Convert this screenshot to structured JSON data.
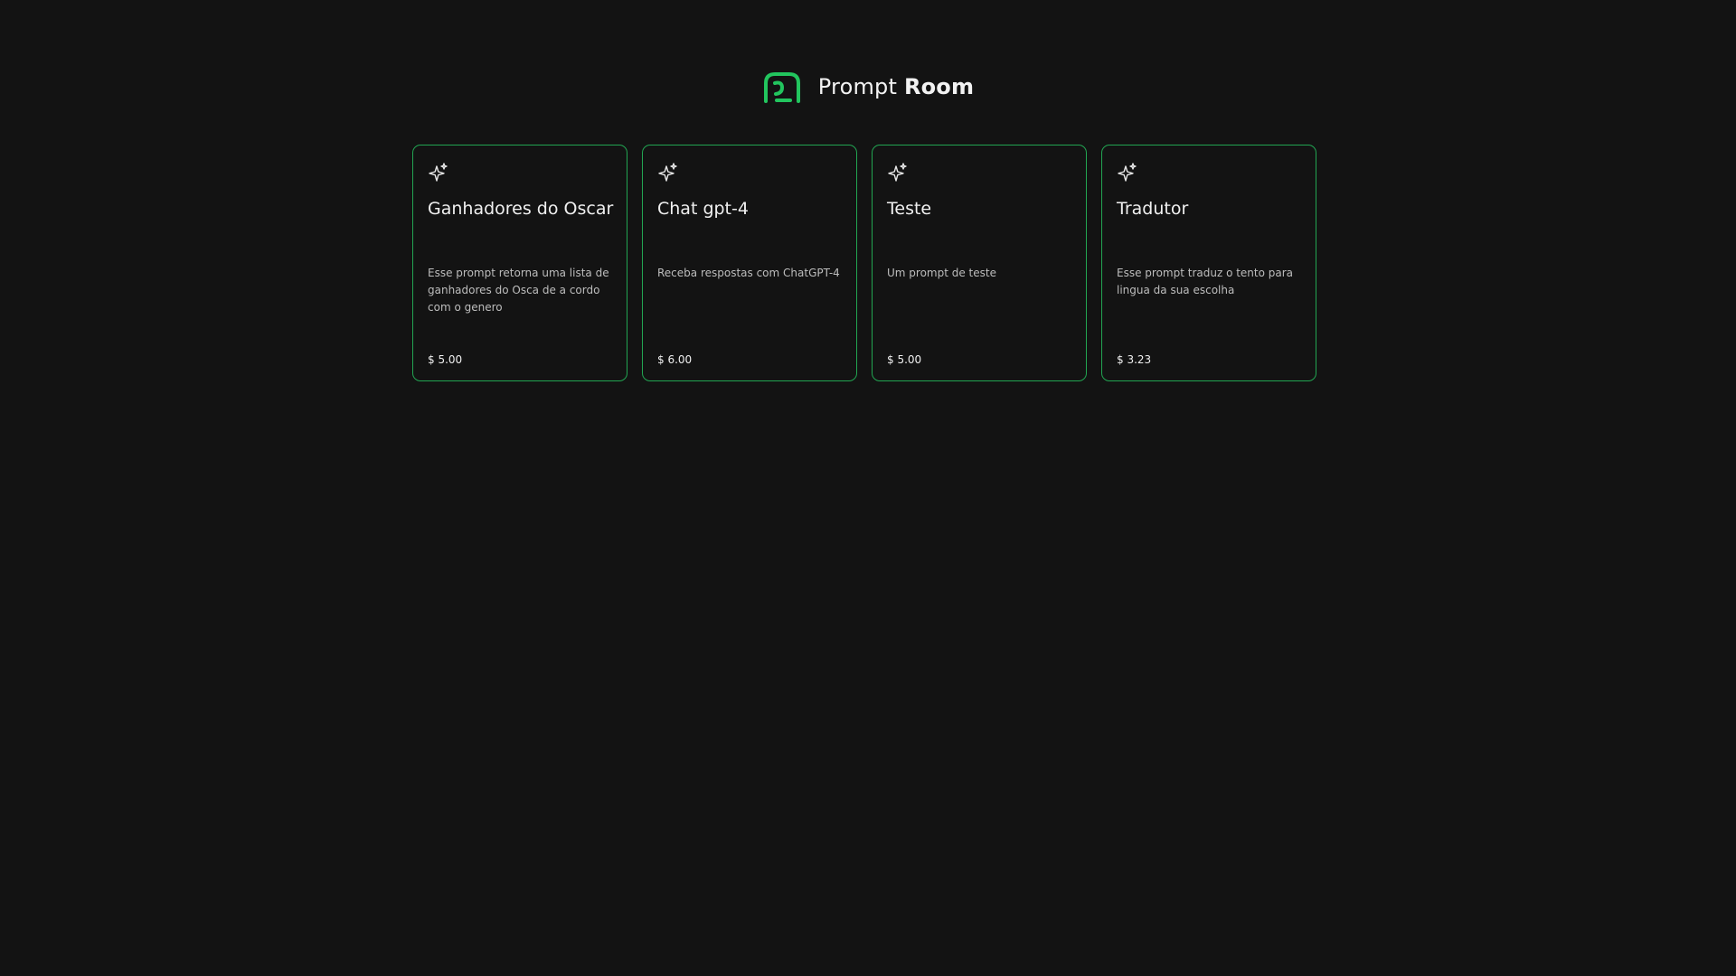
{
  "header": {
    "brand_light": "Prompt",
    "brand_bold": "Room",
    "logo_icon": "prompt-room-logo-icon",
    "accent_color": "#22c55e"
  },
  "cards": [
    {
      "icon": "sparkles-icon",
      "title": "Ganhadores do Oscar",
      "description": "Esse prompt retorna uma lista de ganhadores do Osca de a cordo com o genero",
      "price": "$ 5.00"
    },
    {
      "icon": "sparkles-icon",
      "title": "Chat gpt-4",
      "description": "Receba respostas com ChatGPT-4",
      "price": "$ 6.00"
    },
    {
      "icon": "sparkles-icon",
      "title": "Teste",
      "description": "Um prompt de teste",
      "price": "$ 5.00"
    },
    {
      "icon": "sparkles-icon",
      "title": "Tradutor",
      "description": "Esse prompt traduz o tento para lingua da sua escolha",
      "price": "$ 3.23"
    }
  ]
}
